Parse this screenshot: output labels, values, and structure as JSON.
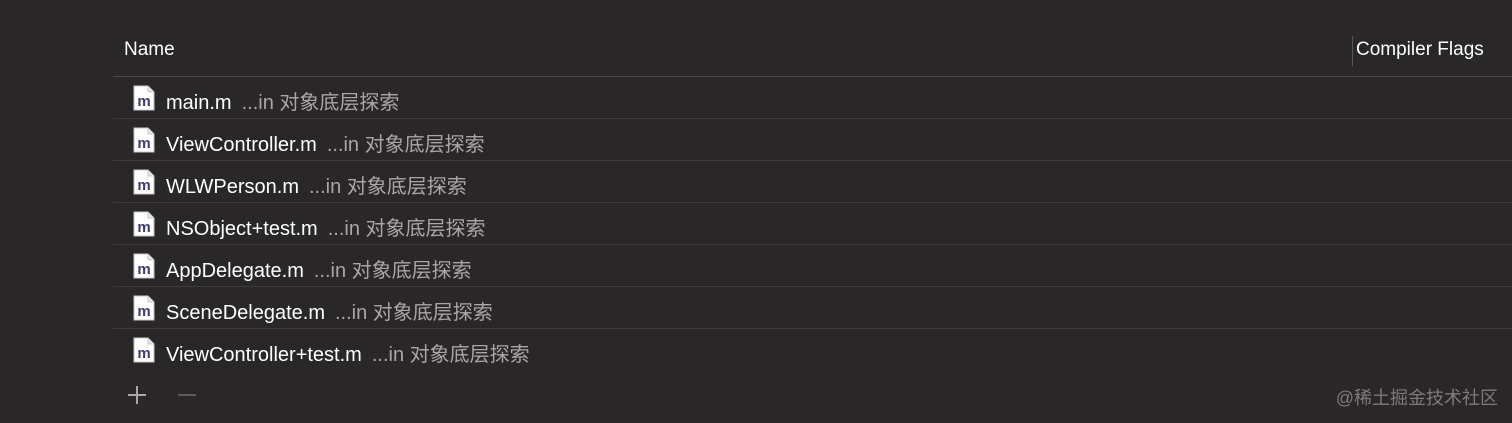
{
  "table": {
    "columns": {
      "name": "Name",
      "compiler_flags": "Compiler Flags"
    },
    "rows": [
      {
        "file": "main.m",
        "location": "...in 对象底层探索",
        "icon": "objc-m-file-icon"
      },
      {
        "file": "ViewController.m",
        "location": "...in 对象底层探索",
        "icon": "objc-m-file-icon"
      },
      {
        "file": "WLWPerson.m",
        "location": "...in 对象底层探索",
        "icon": "objc-m-file-icon"
      },
      {
        "file": "NSObject+test.m",
        "location": "...in 对象底层探索",
        "icon": "objc-m-file-icon"
      },
      {
        "file": "AppDelegate.m",
        "location": "...in 对象底层探索",
        "icon": "objc-m-file-icon"
      },
      {
        "file": "SceneDelegate.m",
        "location": "...in 对象底层探索",
        "icon": "objc-m-file-icon"
      },
      {
        "file": "ViewController+test.m",
        "location": "...in 对象底层探索",
        "icon": "objc-m-file-icon"
      }
    ]
  },
  "footer": {
    "add_icon": "plus-icon",
    "remove_icon": "minus-icon",
    "watermark": "@稀土掘金技术社区"
  },
  "colors": {
    "background": "#2a2729",
    "icon_letter": "#3f3a6e"
  }
}
